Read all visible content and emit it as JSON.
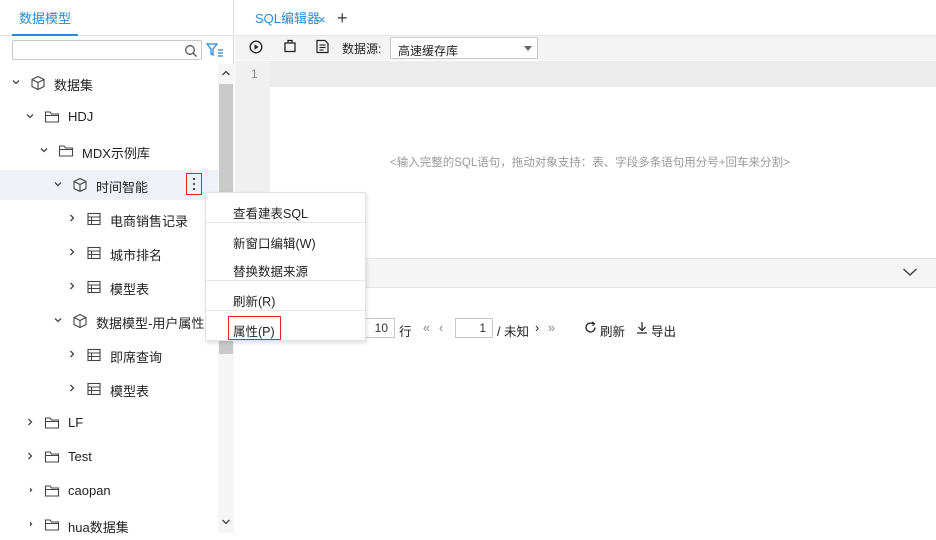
{
  "left_panel": {
    "tab": "数据模型",
    "search": {
      "value": "",
      "placeholder": ""
    },
    "tree": [
      {
        "label": "数据集",
        "type": "dataset-root",
        "expanded": true
      },
      {
        "label": "HDJ",
        "type": "folder",
        "expanded": true
      },
      {
        "label": "MDX示例库",
        "type": "folder",
        "expanded": true
      },
      {
        "label": "时间智能",
        "type": "model",
        "expanded": true,
        "selected": true
      },
      {
        "label": "电商销售记录",
        "type": "table"
      },
      {
        "label": "城市排名",
        "type": "table"
      },
      {
        "label": "模型表",
        "type": "table"
      },
      {
        "label": "数据模型-用户属性及函",
        "type": "model",
        "expanded": true
      },
      {
        "label": "即席查询",
        "type": "table"
      },
      {
        "label": "模型表",
        "type": "table"
      },
      {
        "label": "LF",
        "type": "folder"
      },
      {
        "label": "Test",
        "type": "folder"
      },
      {
        "label": "caopan",
        "type": "folder"
      },
      {
        "label": "hua数据集",
        "type": "folder"
      }
    ]
  },
  "editor": {
    "tab_label": "SQL编辑器",
    "tab_close": "×",
    "tab_add": "+",
    "datasource_label": "数据源:",
    "datasource_value": "高速缓存库",
    "line_number": "1",
    "placeholder": "<输入完整的SQL语句，拖动对象支持：表、字段多条语句用分号+回车来分割>"
  },
  "pager": {
    "page_size": "10",
    "rows_label": "行",
    "page": "1",
    "total": "/ 未知",
    "refresh": "刷新",
    "export": "导出"
  },
  "context_menu": {
    "items": [
      "查看建表SQL",
      "新窗口编辑(W)",
      "替换数据来源",
      "刷新(R)",
      "属性(P)"
    ]
  },
  "colors": {
    "accent": "#2a8bd2",
    "highlight": "#e0282a"
  }
}
